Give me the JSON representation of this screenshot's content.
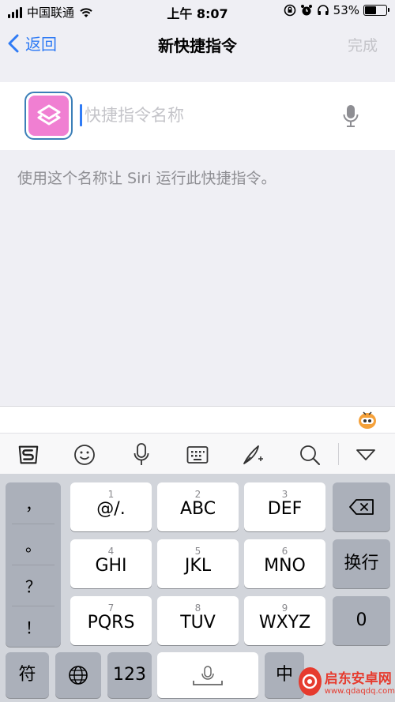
{
  "status_bar": {
    "carrier": "中国联通",
    "time": "上午 8:07",
    "battery_percent": "53%",
    "battery_level": 0.53
  },
  "nav": {
    "back_label": "返回",
    "title": "新快捷指令",
    "done_label": "完成"
  },
  "name_field": {
    "placeholder": "快捷指令名称",
    "value": ""
  },
  "hint_text": "使用这个名称让 Siri 运行此快捷指令。",
  "keyboard": {
    "toolbar_icons": [
      "sogou-logo-icon",
      "emoji-icon",
      "voice-icon",
      "keyboard-layout-icon",
      "handwriting-icon",
      "search-icon",
      "collapse-keyboard-icon"
    ],
    "symbols": [
      "，",
      "。",
      "？",
      "！"
    ],
    "keys": [
      {
        "num": "1",
        "label": "@/."
      },
      {
        "num": "2",
        "label": "ABC"
      },
      {
        "num": "3",
        "label": "DEF"
      },
      {
        "num": "4",
        "label": "GHI"
      },
      {
        "num": "5",
        "label": "JKL"
      },
      {
        "num": "6",
        "label": "MNO"
      },
      {
        "num": "7",
        "label": "PQRS"
      },
      {
        "num": "8",
        "label": "TUV"
      },
      {
        "num": "9",
        "label": "WXYZ"
      }
    ],
    "newline_label": "换行",
    "zero_label": "0",
    "bottom": {
      "symbol_label": "符",
      "num_label": "123",
      "zh_label": "中"
    }
  },
  "watermark": {
    "name": "启东安卓网",
    "url": "www.qdaqdq.com"
  },
  "colors": {
    "accent": "#2f7bf5",
    "shortcut_icon": "#f07fd2",
    "keyboard_bg": "#d2d5db"
  }
}
